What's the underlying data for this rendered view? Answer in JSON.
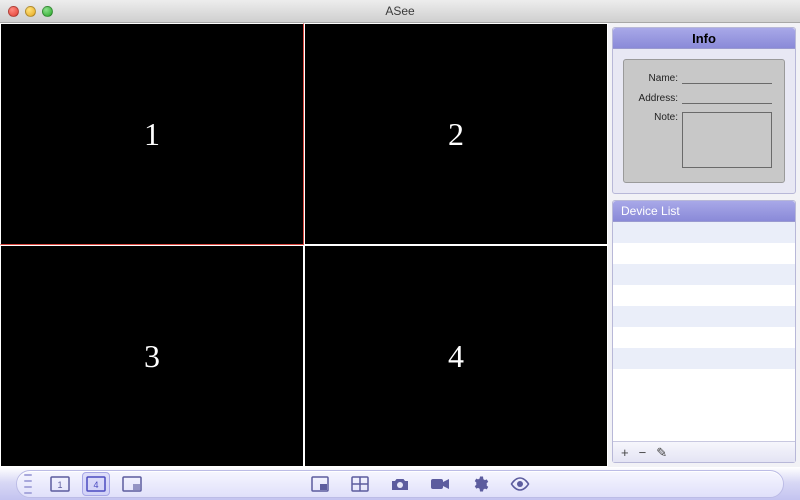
{
  "window": {
    "title": "ASee"
  },
  "grid": {
    "cells": [
      {
        "label": "1",
        "selected": true
      },
      {
        "label": "2",
        "selected": false
      },
      {
        "label": "3",
        "selected": false
      },
      {
        "label": "4",
        "selected": false
      }
    ]
  },
  "info": {
    "title": "Info",
    "name_label": "Name:",
    "address_label": "Address:",
    "note_label": "Note:",
    "name_value": "",
    "address_value": "",
    "note_value": ""
  },
  "device": {
    "title": "Device List",
    "items": [
      "",
      "",
      "",
      "",
      "",
      "",
      "",
      ""
    ],
    "add_label": "+",
    "remove_label": "−",
    "edit_label": "✎"
  },
  "toolbar": {
    "layout1_label": "1",
    "layout4_label": "4"
  },
  "colors": {
    "accent": "#8a8ad8",
    "selected_border": "#d9463e"
  }
}
